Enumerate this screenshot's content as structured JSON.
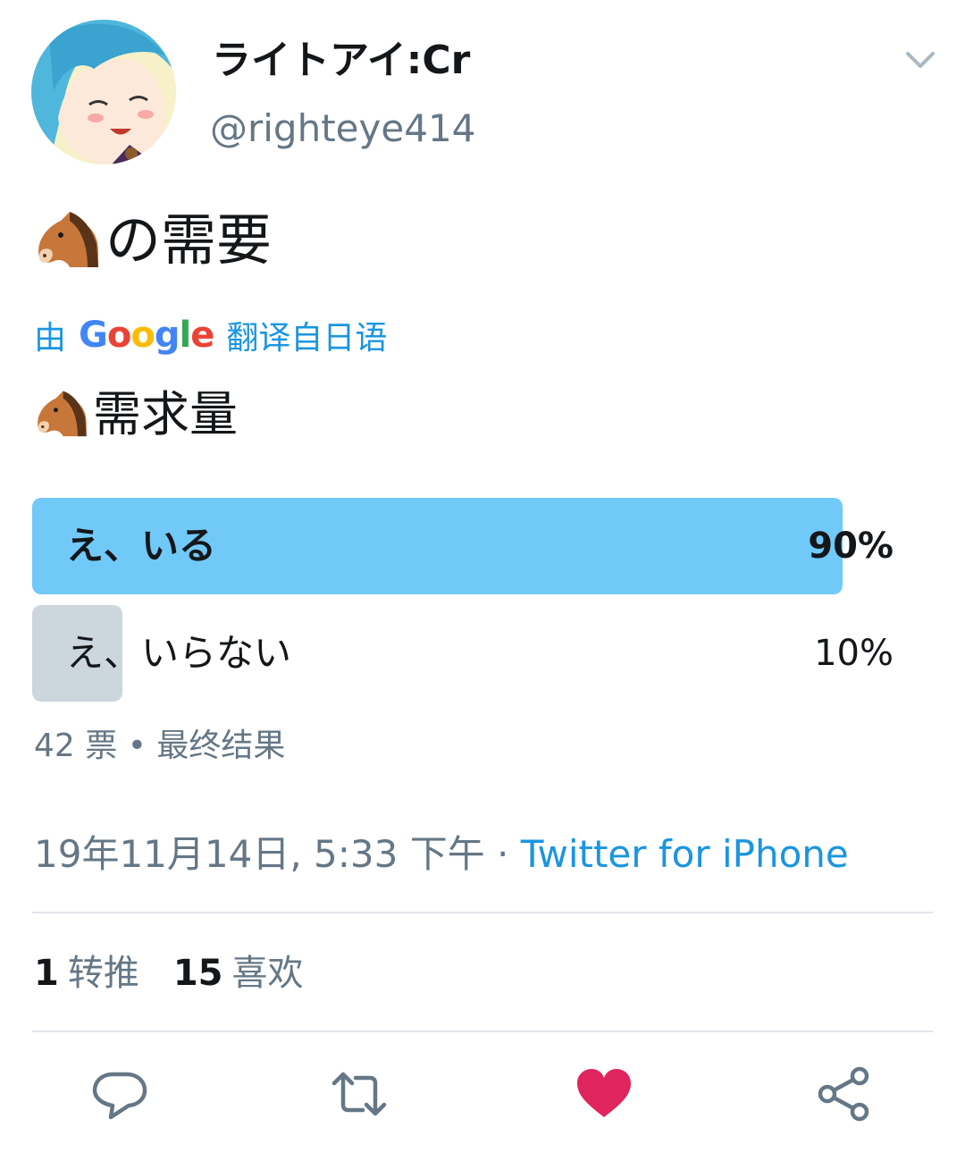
{
  "tweet": {
    "author": {
      "display_name": "ライトアイ:Cr",
      "handle": "@righteye414"
    },
    "text": "の需要",
    "text_emoji": "horse-face",
    "translation": {
      "prefix": "由",
      "provider": "Google",
      "suffix": "翻译自日语",
      "text": "需求量"
    },
    "poll": {
      "options": [
        {
          "label": "え、いる",
          "percent_text": "90%",
          "percent": 90,
          "leading": true
        },
        {
          "label": "え、いらない",
          "percent_text": "10%",
          "percent": 10,
          "leading": false
        }
      ],
      "meta": "42 票 • 最终结果"
    },
    "timestamp": "19年11月14日, 5:33 下午",
    "separator": " · ",
    "source": "Twitter for iPhone",
    "stats": {
      "retweets": "1",
      "retweets_label": "转推",
      "likes": "15",
      "likes_label": "喜欢"
    }
  },
  "colors": {
    "accent": "#1b95e0",
    "poll_leading": "#71c9f8",
    "poll_other": "#ccd6dd",
    "like": "#e0245e",
    "secondary_text": "#657786"
  },
  "icons": [
    "chevron-down-icon",
    "reply-icon",
    "retweet-icon",
    "heart-icon",
    "share-icon"
  ]
}
